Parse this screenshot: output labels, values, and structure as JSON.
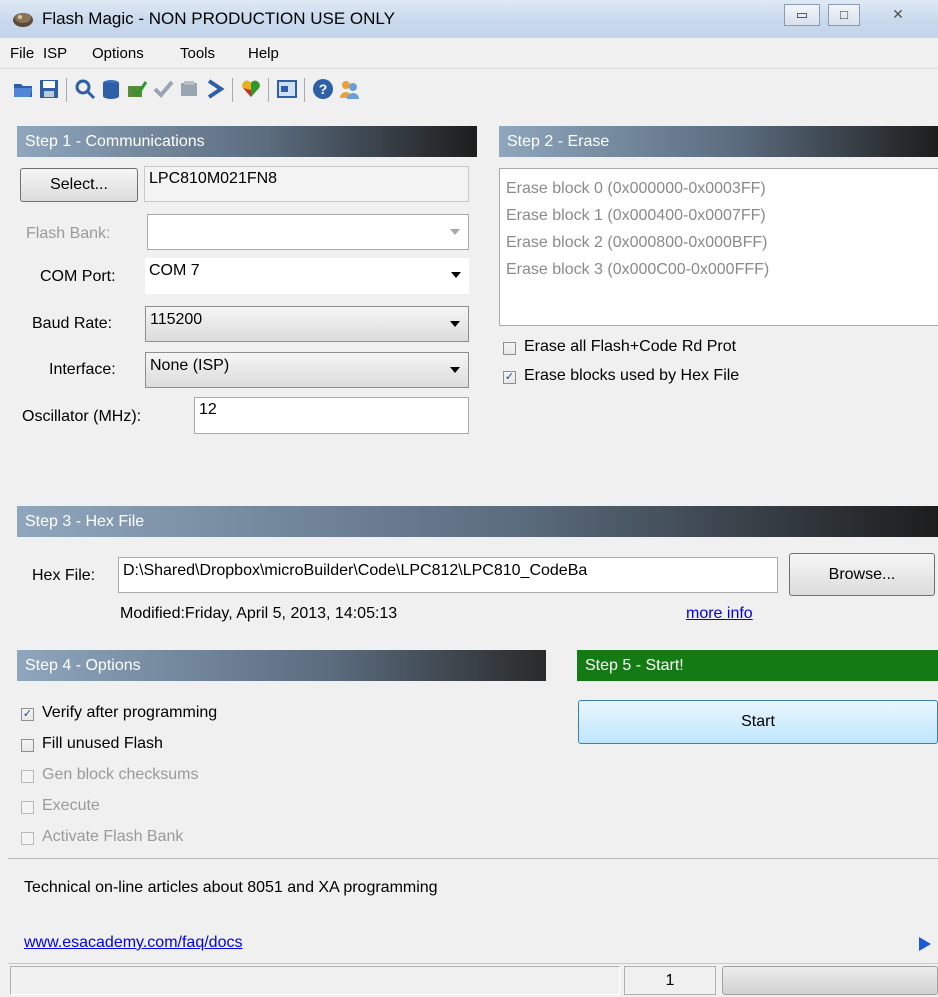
{
  "window": {
    "title": "Flash Magic - NON PRODUCTION USE ONLY"
  },
  "menu": [
    "File",
    "ISP",
    "Options",
    "Tools",
    "Help"
  ],
  "toolbar": {
    "icons": [
      "open-folder-icon",
      "save-icon",
      "search-icon",
      "database-icon",
      "program-icon",
      "verify-check-icon",
      "blank-check-icon",
      "go-icon",
      "heart-icon",
      "window-icon",
      "help-icon",
      "users-icon"
    ]
  },
  "step1": {
    "header": "Step 1 - Communications",
    "select_label": "Select...",
    "device": "LPC810M021FN8",
    "flash_bank_label": "Flash Bank:",
    "flash_bank_value": "",
    "com_port_label": "COM Port:",
    "com_port_value": "COM 7",
    "baud_label": "Baud Rate:",
    "baud_value": "115200",
    "interface_label": "Interface:",
    "interface_value": "None (ISP)",
    "oscillator_label": "Oscillator (MHz):",
    "oscillator_value": "12"
  },
  "step2": {
    "header": "Step 2 - Erase",
    "blocks": [
      "Erase block 0 (0x000000-0x0003FF)",
      "Erase block 1 (0x000400-0x0007FF)",
      "Erase block 2 (0x000800-0x000BFF)",
      "Erase block 3 (0x000C00-0x000FFF)"
    ],
    "erase_all_label": "Erase all Flash+Code Rd Prot",
    "erase_all_checked": false,
    "erase_used_label": "Erase blocks used by Hex File",
    "erase_used_checked": true
  },
  "step3": {
    "header": "Step 3 - Hex File",
    "hex_label": "Hex File:",
    "hex_value": "D:\\Shared\\Dropbox\\microBuilder\\Code\\LPC812\\LPC810_CodeBa",
    "browse_label": "Browse...",
    "modified": "Modified:Friday, April 5, 2013, 14:05:13",
    "more_info": "more info"
  },
  "step4": {
    "header": "Step 4 - Options",
    "options": [
      {
        "label": "Verify after programming",
        "checked": true,
        "enabled": true
      },
      {
        "label": "Fill unused Flash",
        "checked": false,
        "enabled": true
      },
      {
        "label": "Gen block checksums",
        "checked": false,
        "enabled": false
      },
      {
        "label": "Execute",
        "checked": false,
        "enabled": false
      },
      {
        "label": "Activate Flash Bank",
        "checked": false,
        "enabled": false
      }
    ]
  },
  "step5": {
    "header": "Step 5 - Start!",
    "start_label": "Start"
  },
  "footer": {
    "info_text": "Technical on-line articles about 8051 and XA programming",
    "link": "www.esacademy.com/faq/docs",
    "status_page": "1"
  }
}
